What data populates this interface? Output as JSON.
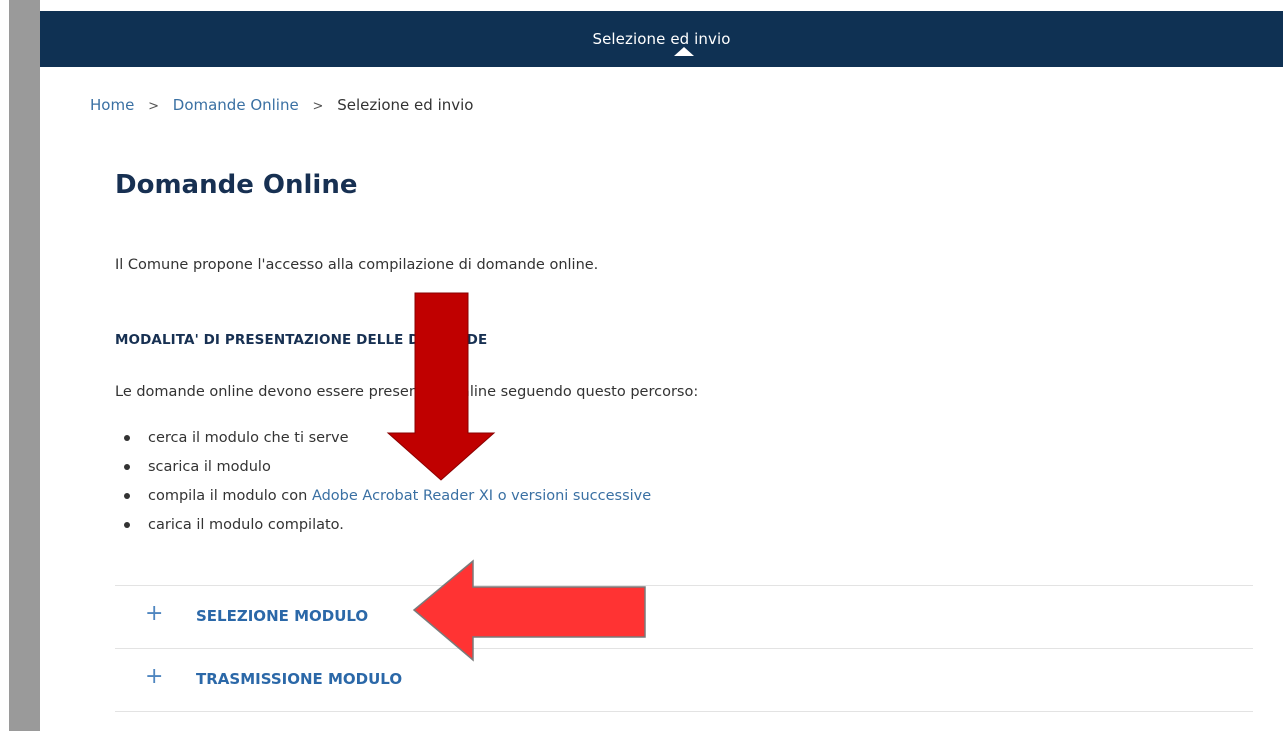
{
  "header": {
    "nav_label": "Selezione ed invio"
  },
  "breadcrumb": {
    "items": [
      "Home",
      "Domande Online",
      "Selezione ed invio"
    ],
    "separator": ">"
  },
  "page": {
    "title": "Domande Online",
    "intro": "Il Comune propone l'accesso alla compilazione di domande online.",
    "section_heading": "MODALITA' DI PRESENTAZIONE DELLE DOMANDE",
    "instructions": "Le domande online devono essere presentate online seguendo questo percorso:",
    "steps": [
      {
        "text": "cerca il modulo che ti serve"
      },
      {
        "text": "scarica il modulo"
      },
      {
        "text": "compila il modulo con ",
        "link": "Adobe Acrobat Reader XI o versioni successive"
      },
      {
        "text": "carica il modulo compilato."
      }
    ]
  },
  "accordion": [
    {
      "icon": "plus-icon",
      "label": "SELEZIONE MODULO"
    },
    {
      "icon": "plus-icon",
      "label": "TRASMISSIONE MODULO"
    }
  ],
  "annotations": {
    "down_arrow_color": "#c00000",
    "left_arrow_color": "#ff3333"
  },
  "colors": {
    "nav_bg": "#0f3153",
    "title": "#173052",
    "link": "#3a70a3",
    "accordion_label": "#2b68a8"
  }
}
